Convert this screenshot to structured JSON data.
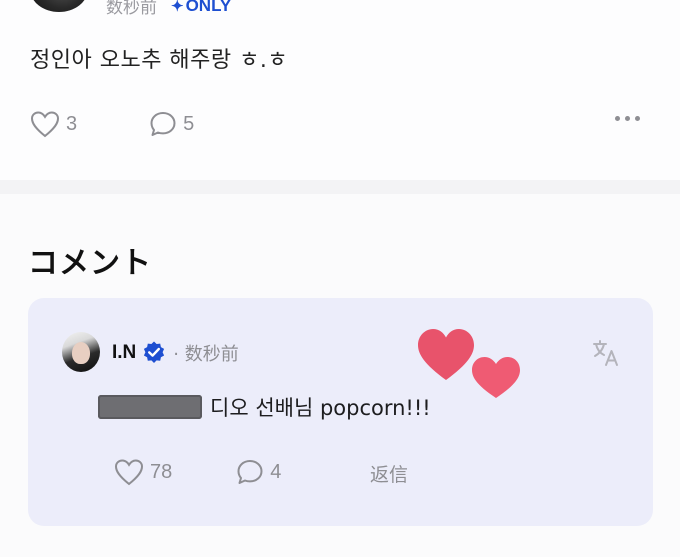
{
  "post": {
    "timestamp": "数秒前",
    "badge": "ONLY",
    "text": "정인아 오노추 해주랑 ㅎ.ㅎ",
    "like_count": "3",
    "comment_count": "5",
    "icons": {
      "like": "heart-icon",
      "comment": "comment-bubble-icon",
      "more": "more-dots-icon",
      "badge": "sparkle-icon"
    }
  },
  "comments": {
    "title": "コメント",
    "items": [
      {
        "author": "I.N",
        "timestamp": "· 数秒前",
        "text": "디오 선배님 popcorn!!!",
        "like_count": "78",
        "reply_count": "4",
        "reply_label": "返信",
        "icons": {
          "verified": "verified-badge-icon",
          "translate": "translate-icon",
          "decoration": "hearts-sticker"
        }
      }
    ]
  },
  "colors": {
    "accent": "#1e4fd1",
    "card_bg": "#ecedfa",
    "muted": "#8e8e93",
    "heart": "#e8536b"
  }
}
